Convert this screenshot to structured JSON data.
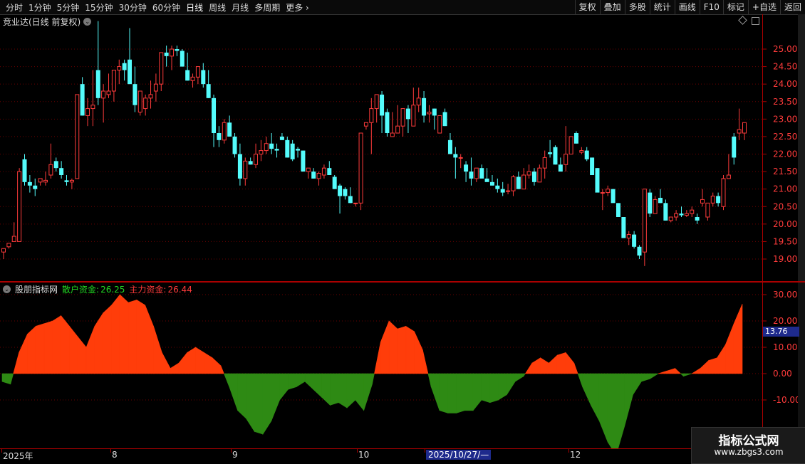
{
  "toolbar": {
    "periods": [
      "分时",
      "1分钟",
      "5分钟",
      "15分钟",
      "30分钟",
      "60分钟",
      "日线",
      "周线",
      "月线",
      "多周期",
      "更多"
    ],
    "tools": [
      "复权",
      "叠加",
      "多股",
      "统计",
      "画线",
      "F10",
      "标记",
      "+自选",
      "返回"
    ]
  },
  "stock": {
    "title": "竞业达(日线 前复权)"
  },
  "indicator": {
    "name": "股朋指标网",
    "retail_label": "散户资金:",
    "retail_value": "26.25",
    "main_label": "主力资金:",
    "main_value": "26.44",
    "current_value": "13.76"
  },
  "price_axis": {
    "ticks": [
      "25.00",
      "24.50",
      "24.00",
      "23.50",
      "23.00",
      "22.50",
      "22.00",
      "21.50",
      "21.00",
      "20.50",
      "20.00",
      "19.50",
      "19.00"
    ]
  },
  "ind_axis": {
    "ticks": [
      "30.00",
      "20.00",
      "10.00",
      "0.00",
      "-10.00"
    ]
  },
  "date_axis": {
    "labels": [
      "2025年",
      "8",
      "9",
      "10",
      "2025/10/27/—",
      "12"
    ]
  },
  "watermark": {
    "line1": "指标公式网",
    "line2": "www.zbgs3.com"
  },
  "colors": {
    "up": "#ff3b3b",
    "down": "#54fcfc",
    "pos": "#ff3d0a",
    "neg": "#2e8a14",
    "grid": "#6a0000"
  },
  "chart_data": {
    "type": "candlestick",
    "candles": [
      [
        19.2,
        19.3,
        19.0,
        19.3
      ],
      [
        19.35,
        19.45,
        19.3,
        19.45
      ],
      [
        19.5,
        20.05,
        19.5,
        19.65
      ],
      [
        19.5,
        21.6,
        19.5,
        21.5
      ],
      [
        21.85,
        22.0,
        21.1,
        21.2
      ],
      [
        21.2,
        21.4,
        20.9,
        21.1
      ],
      [
        21.1,
        21.3,
        20.8,
        21.0
      ],
      [
        21.2,
        21.3,
        21.1,
        21.3
      ],
      [
        21.2,
        21.5,
        21.1,
        21.25
      ],
      [
        21.4,
        22.3,
        21.3,
        21.7
      ],
      [
        21.8,
        21.9,
        21.5,
        21.6
      ],
      [
        21.6,
        21.8,
        21.3,
        21.4
      ],
      [
        21.25,
        21.4,
        21.1,
        21.2
      ],
      [
        21.2,
        21.3,
        21.0,
        21.25
      ],
      [
        21.3,
        23.6,
        21.3,
        23.7
      ],
      [
        24.0,
        24.2,
        23.1,
        23.1
      ],
      [
        23.1,
        23.6,
        22.8,
        23.3
      ],
      [
        23.3,
        24.4,
        22.8,
        23.4
      ],
      [
        24.4,
        25.8,
        23.4,
        23.6
      ],
      [
        23.6,
        24.0,
        22.9,
        23.8
      ],
      [
        23.7,
        24.3,
        23.6,
        23.8
      ],
      [
        23.8,
        24.1,
        23.5,
        24.4
      ],
      [
        24.4,
        24.7,
        24.0,
        24.5
      ],
      [
        24.6,
        24.7,
        24.1,
        24.4
      ],
      [
        24.7,
        25.6,
        24.0,
        24.0
      ],
      [
        24.0,
        24.5,
        23.2,
        23.4
      ],
      [
        23.2,
        23.7,
        23.1,
        23.8
      ],
      [
        23.3,
        23.7,
        23.1,
        23.6
      ],
      [
        23.6,
        24.1,
        23.3,
        23.7
      ],
      [
        23.8,
        24.3,
        23.5,
        24.0
      ],
      [
        24.0,
        24.9,
        23.8,
        24.9
      ],
      [
        24.9,
        25.1,
        24.5,
        24.8
      ],
      [
        24.8,
        25.1,
        24.4,
        25.0
      ],
      [
        25.0,
        25.1,
        24.8,
        24.95
      ],
      [
        24.95,
        25.0,
        24.6,
        24.5
      ],
      [
        24.4,
        24.9,
        24.1,
        24.1
      ],
      [
        24.1,
        24.3,
        23.9,
        24.2
      ],
      [
        24.2,
        24.5,
        24.0,
        24.5
      ],
      [
        24.4,
        24.6,
        23.9,
        24.0
      ],
      [
        24.0,
        24.4,
        23.6,
        23.6
      ],
      [
        23.6,
        23.7,
        22.2,
        22.6
      ],
      [
        22.6,
        22.8,
        22.2,
        22.4
      ],
      [
        22.4,
        23.0,
        22.3,
        22.9
      ],
      [
        22.9,
        23.1,
        22.5,
        22.5
      ],
      [
        22.5,
        22.6,
        21.9,
        22.0
      ],
      [
        22.0,
        22.3,
        21.1,
        21.3
      ],
      [
        21.3,
        21.9,
        21.1,
        21.8
      ],
      [
        21.8,
        21.9,
        21.7,
        21.7
      ],
      [
        21.7,
        22.3,
        21.6,
        22.0
      ],
      [
        22.0,
        22.4,
        21.8,
        22.1
      ],
      [
        22.1,
        22.5,
        22.0,
        22.3
      ],
      [
        22.3,
        22.6,
        22.0,
        22.15
      ],
      [
        22.15,
        22.3,
        21.9,
        22.1
      ],
      [
        22.5,
        22.6,
        22.4,
        22.4
      ],
      [
        22.4,
        22.5,
        21.9,
        21.9
      ],
      [
        22.3,
        22.4,
        21.8,
        21.85
      ],
      [
        22.15,
        22.2,
        21.9,
        22.1
      ],
      [
        22.1,
        22.1,
        21.5,
        21.5
      ],
      [
        21.5,
        21.6,
        21.3,
        21.6
      ],
      [
        21.5,
        21.6,
        21.3,
        21.3
      ],
      [
        21.3,
        21.5,
        21.1,
        21.45
      ],
      [
        21.4,
        21.7,
        21.3,
        21.6
      ],
      [
        21.6,
        21.8,
        21.5,
        21.4
      ],
      [
        21.35,
        21.4,
        21.0,
        21.0
      ],
      [
        21.1,
        21.15,
        20.3,
        20.8
      ],
      [
        21.0,
        21.05,
        20.7,
        20.8
      ],
      [
        20.8,
        21.05,
        20.6,
        20.6
      ],
      [
        20.6,
        20.6,
        20.5,
        20.6
      ],
      [
        20.6,
        22.6,
        20.4,
        22.6
      ],
      [
        22.8,
        22.9,
        22.7,
        22.9
      ],
      [
        22.9,
        23.6,
        22.0,
        23.3
      ],
      [
        23.3,
        23.5,
        22.9,
        23.7
      ],
      [
        23.7,
        23.8,
        22.6,
        23.1
      ],
      [
        23.2,
        23.3,
        22.5,
        22.6
      ],
      [
        22.5,
        23.2,
        22.6,
        22.6
      ],
      [
        22.6,
        23.4,
        22.6,
        22.8
      ],
      [
        22.8,
        23.1,
        22.5,
        23.3
      ],
      [
        23.3,
        23.4,
        22.6,
        23.0
      ],
      [
        22.8,
        23.9,
        22.8,
        23.4
      ],
      [
        23.4,
        23.9,
        23.2,
        23.6
      ],
      [
        23.6,
        23.8,
        22.9,
        23.1
      ],
      [
        23.15,
        23.4,
        22.9,
        23.2
      ],
      [
        23.3,
        23.3,
        22.7,
        23.1
      ],
      [
        22.6,
        23.1,
        22.6,
        23.1
      ],
      [
        23.2,
        23.3,
        22.8,
        22.8
      ],
      [
        22.4,
        22.6,
        22.0,
        22.0
      ],
      [
        22.0,
        22.2,
        21.3,
        21.9
      ],
      [
        21.9,
        22.0,
        21.6,
        21.9
      ],
      [
        21.7,
        21.8,
        21.2,
        21.5
      ],
      [
        21.5,
        21.9,
        21.1,
        21.3
      ],
      [
        21.3,
        21.6,
        21.2,
        21.6
      ],
      [
        21.6,
        21.7,
        21.4,
        21.3
      ],
      [
        21.3,
        21.6,
        21.3,
        21.2
      ],
      [
        21.2,
        21.4,
        21.1,
        21.1
      ],
      [
        21.1,
        21.3,
        20.9,
        21.0
      ],
      [
        21.0,
        21.2,
        20.8,
        20.9
      ],
      [
        20.95,
        21.15,
        20.85,
        20.95
      ],
      [
        20.95,
        21.4,
        20.8,
        21.35
      ],
      [
        21.35,
        21.5,
        21.0,
        21.0
      ],
      [
        21.0,
        21.6,
        21.0,
        21.4
      ],
      [
        21.4,
        21.7,
        21.3,
        21.5
      ],
      [
        21.5,
        21.6,
        21.1,
        21.2
      ],
      [
        21.2,
        21.7,
        21.2,
        21.6
      ],
      [
        21.6,
        22.1,
        21.3,
        21.9
      ],
      [
        22.05,
        22.4,
        21.9,
        22.0
      ],
      [
        22.2,
        22.25,
        21.7,
        21.7
      ],
      [
        21.7,
        21.9,
        21.5,
        21.5
      ],
      [
        21.7,
        22.8,
        21.5,
        22.0
      ],
      [
        22.0,
        22.5,
        22.2,
        22.5
      ],
      [
        22.6,
        22.65,
        22.3,
        22.3
      ],
      [
        22.05,
        22.2,
        22.0,
        22.1
      ],
      [
        22.1,
        22.2,
        21.8,
        21.85
      ],
      [
        21.9,
        21.9,
        21.4,
        21.4
      ],
      [
        21.6,
        21.6,
        21.3,
        20.9
      ],
      [
        20.9,
        21.0,
        20.4,
        20.9
      ],
      [
        20.9,
        21.1,
        20.8,
        21.0
      ],
      [
        21.0,
        21.0,
        20.7,
        20.6
      ],
      [
        20.6,
        20.6,
        20.2,
        20.2
      ],
      [
        20.2,
        20.2,
        19.6,
        19.6
      ],
      [
        19.6,
        19.8,
        19.4,
        19.7
      ],
      [
        19.7,
        19.8,
        19.3,
        19.35
      ],
      [
        19.35,
        19.4,
        19.0,
        19.1
      ],
      [
        19.2,
        21.0,
        18.8,
        21.0
      ],
      [
        20.9,
        21.0,
        20.2,
        20.3
      ],
      [
        20.3,
        20.8,
        20.3,
        20.7
      ],
      [
        20.75,
        21.0,
        20.6,
        20.6
      ],
      [
        20.6,
        20.7,
        20.1,
        20.1
      ],
      [
        20.1,
        20.2,
        20.05,
        20.2
      ],
      [
        20.2,
        20.4,
        20.1,
        20.3
      ],
      [
        20.3,
        20.5,
        20.2,
        20.25
      ],
      [
        20.25,
        20.4,
        20.2,
        20.3
      ],
      [
        20.3,
        20.5,
        20.2,
        20.4
      ],
      [
        20.2,
        20.3,
        20.0,
        20.1
      ],
      [
        20.6,
        21.0,
        20.5,
        20.7
      ],
      [
        20.2,
        20.6,
        20.1,
        20.6
      ],
      [
        20.6,
        20.9,
        20.5,
        20.8
      ],
      [
        20.8,
        20.9,
        20.5,
        20.6
      ],
      [
        20.5,
        21.4,
        20.4,
        21.3
      ],
      [
        21.3,
        22.0,
        21.3,
        21.4
      ],
      [
        22.5,
        22.6,
        21.7,
        21.9
      ],
      [
        22.6,
        23.3,
        22.4,
        22.7
      ],
      [
        22.6,
        22.9,
        22.4,
        22.9
      ]
    ],
    "indicator_values": [
      -3,
      -4,
      8,
      15,
      18,
      19,
      20,
      22,
      18,
      14,
      10,
      18,
      23,
      26,
      30,
      27,
      28,
      26,
      18,
      8,
      2,
      4,
      8,
      10,
      8,
      6,
      3,
      -5,
      -14,
      -17,
      -22,
      -23,
      -18,
      -10,
      -6,
      -5,
      -3,
      -6,
      -9,
      -12,
      -11,
      -13,
      -10,
      -14,
      -4,
      12,
      20,
      17,
      18,
      16,
      9,
      -5,
      -14,
      -15,
      -15,
      -14,
      -14,
      -10,
      -11,
      -10,
      -8,
      -3,
      -1,
      4,
      6,
      4,
      7,
      8,
      4,
      -5,
      -12,
      -18,
      -26,
      -31,
      -20,
      -8,
      -3,
      -2,
      0,
      1,
      2,
      -1,
      0,
      2,
      5,
      6,
      11,
      19,
      26.44
    ],
    "price_range": [
      18.5,
      25.6
    ],
    "ind_range": [
      -32,
      32
    ]
  }
}
